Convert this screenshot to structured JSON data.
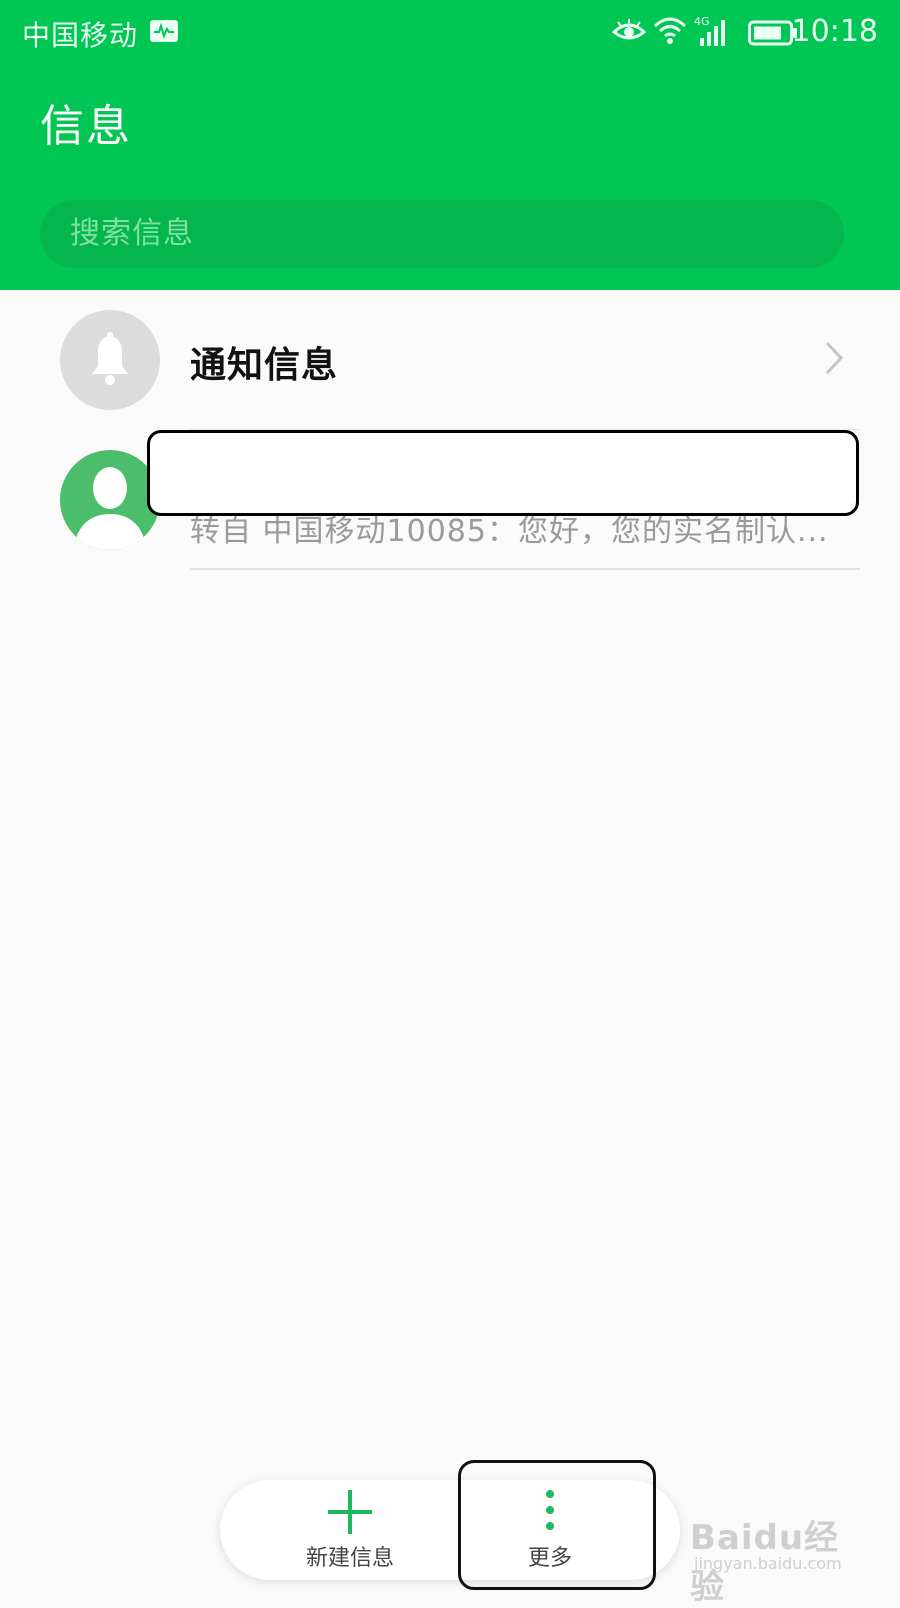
{
  "status_bar": {
    "carrier": "中国移动",
    "network_label": "4G",
    "time": "10:18",
    "icons": [
      "activity-icon",
      "eye-icon",
      "wifi-icon",
      "signal-icon",
      "battery-icon"
    ]
  },
  "header": {
    "title": "信息",
    "search_placeholder": "搜索信息"
  },
  "conversations": [
    {
      "title": "通知信息",
      "icon": "bell-icon"
    },
    {
      "title": "",
      "preview": "转自 中国移动10085：您好，您的实名制认...",
      "icon": "contact-avatar-icon"
    }
  ],
  "bottom_bar": {
    "new_message_label": "新建信息",
    "more_label": "更多"
  },
  "watermark": {
    "main": "Baidu经验",
    "sub": "jingyan.baidu.com"
  },
  "colors": {
    "brand_green": "#00c653",
    "search_bg": "#04b64b",
    "accent_green": "#1fb85a"
  }
}
